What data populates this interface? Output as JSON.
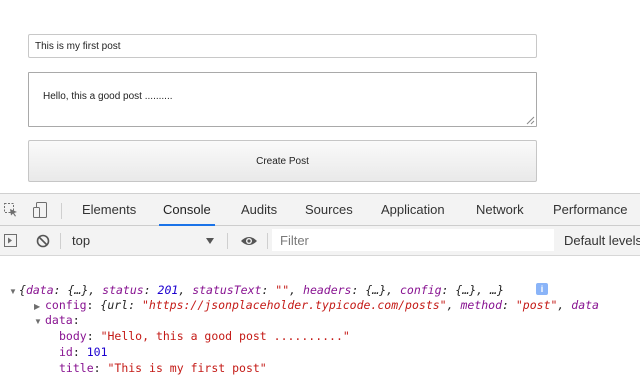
{
  "form": {
    "title_value": "This is my first post",
    "body_value": "Hello, this a good post ..........",
    "submit_label": "Create Post"
  },
  "devtools": {
    "tabs": [
      {
        "label": "Elements",
        "active": false
      },
      {
        "label": "Console",
        "active": true
      },
      {
        "label": "Audits",
        "active": false
      },
      {
        "label": "Sources",
        "active": false
      },
      {
        "label": "Application",
        "active": false
      },
      {
        "label": "Network",
        "active": false
      },
      {
        "label": "Performance",
        "active": false
      }
    ],
    "accent_color": "#1a73e8"
  },
  "console_toolbar": {
    "context": "top",
    "filter_placeholder": "Filter",
    "levels": "Default levels"
  },
  "console_output": {
    "summary": {
      "open_brace": "{",
      "data_key": "data",
      "data_val": "{…}",
      "status_key": "status",
      "status_val": "201",
      "status_text_key": "statusText",
      "status_text_val": "\"\"",
      "headers_key": "headers",
      "headers_val": "{…}",
      "config_key": "config",
      "config_val": "{…}",
      "ellipsis": "…",
      "close_brace": "}",
      "info_icon": "i"
    },
    "config_row": {
      "key": "config",
      "open": "{url: ",
      "url": "\"https://jsonplaceholder.typicode.com/posts\"",
      "method_key": "method",
      "method_val": "\"post\"",
      "rest": "data"
    },
    "data_row": {
      "key": "data"
    },
    "data_fields": {
      "body_key": "body",
      "body_val": "\"Hello, this a good post ..........\"",
      "id_key": "id",
      "id_val": "101",
      "title_key": "title",
      "title_val": "\"This is my first post\""
    }
  }
}
